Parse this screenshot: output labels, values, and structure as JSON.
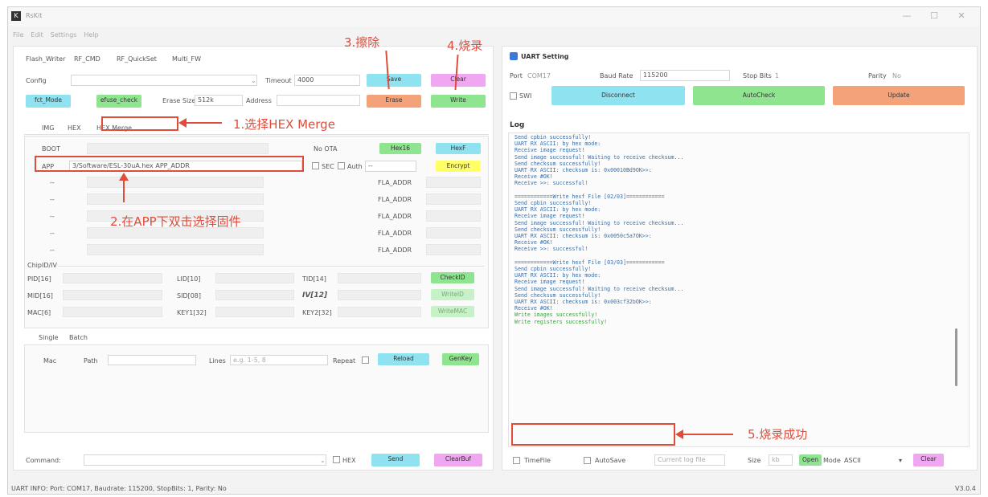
{
  "window": {
    "app_title": "RsKit",
    "logo": "K",
    "minimize": "—",
    "maximize": "☐",
    "close": "✕"
  },
  "menu": [
    "File",
    "Edit",
    "Settings",
    "Help"
  ],
  "tabs_top": [
    "Flash_Writer",
    "RF_CMD",
    "RF_QuickSet",
    "Multi_FW"
  ],
  "flash": {
    "config_label": "Config",
    "timeout_label": "Timeout",
    "timeout_value": "4000",
    "save": "Save",
    "clear": "Clear",
    "fct_mode": "fct_Mode",
    "efuse_check": "efuse_check",
    "erase_size_label": "Erase Size",
    "erase_size": "512k",
    "address_label": "Address",
    "erase": "Erase",
    "write": "Write"
  },
  "sub_tabs": [
    "IMG",
    "HEX",
    "HEX Merge"
  ],
  "hex_merge": {
    "boot": "BOOT",
    "no_ota": "No OTA",
    "hex16": "Hex16",
    "hexf": "HexF",
    "app": "APP",
    "app_path": "3/Software/ESL-30uA.hex",
    "app_addr": "APP_ADDR",
    "sec": "SEC",
    "auth": "Auth",
    "auth_value": "--",
    "encrypt": "Encrypt",
    "rows": [
      {
        "sel": "--",
        "addr": "FLA_ADDR"
      },
      {
        "sel": "--",
        "addr": "FLA_ADDR"
      },
      {
        "sel": "--",
        "addr": "FLA_ADDR"
      },
      {
        "sel": "--",
        "addr": "FLA_ADDR"
      },
      {
        "sel": "--",
        "addr": "FLA_ADDR"
      }
    ]
  },
  "chip": {
    "title": "ChipID/IV",
    "pid": "PID[16]",
    "lid": "LID[10]",
    "tid": "TID[14]",
    "checkid": "CheckID",
    "mid": "MID[16]",
    "sid": "SID[08]",
    "iv": "IV[12]",
    "writeid": "WriteID",
    "mac": "MAC[6]",
    "key1": "KEY1[32]",
    "key2": "KEY2[32]",
    "writemac": "WriteMAC"
  },
  "batch_tabs": [
    "Single",
    "Batch"
  ],
  "batch": {
    "mac": "Mac",
    "path": "Path",
    "lines_label": "Lines",
    "lines_placeholder": "e.g. 1-5, 8",
    "repeat": "Repeat",
    "reload": "Reload",
    "genkey": "GenKey"
  },
  "command": {
    "label": "Command:",
    "hex": "HEX",
    "send": "Send",
    "clearbuf": "ClearBuf"
  },
  "status_bar": {
    "info": "UART INFO: Port: COM17, Baudrate: 115200, StopBits: 1, Parity: No",
    "version": "V3.0.4"
  },
  "uart": {
    "title": "UART Setting",
    "port_label": "Port",
    "port": "COM17",
    "baud_label": "Baud Rate",
    "baud": "115200",
    "stop_label": "Stop Bits",
    "stop": "1",
    "parity_label": "Parity",
    "parity": "No",
    "swi": "SWI",
    "disconnect": "Disconnect",
    "autocheck": "AutoCheck",
    "update": "Update"
  },
  "log": {
    "title": "Log",
    "lines": [
      {
        "text": "Send cpbin successfully!",
        "green": false
      },
      {
        "text": "UART RX ASCII: by hex mode:",
        "green": false
      },
      {
        "text": "Receive image request!",
        "green": false
      },
      {
        "text": "Send image successful! Waiting to receive checksum...",
        "green": false
      },
      {
        "text": "Send checksum successfully!",
        "green": false
      },
      {
        "text": "UART RX ASCII: checksum is: 0x00010Bd9OK>>:",
        "green": false
      },
      {
        "text": "Receive #OK!",
        "green": false
      },
      {
        "text": "Receive >>: successful!",
        "green": false
      },
      {
        "text": "",
        "green": false
      },
      {
        "text": "============Write hexf File [02/03]============",
        "green": false
      },
      {
        "text": "Send cpbin successfully!",
        "green": false
      },
      {
        "text": "UART RX ASCII: by hex mode:",
        "green": false
      },
      {
        "text": "Receive image request!",
        "green": false
      },
      {
        "text": "Send image successful! Waiting to receive checksum...",
        "green": false
      },
      {
        "text": "Send checksum successfully!",
        "green": false
      },
      {
        "text": "UART RX ASCII: checksum is: 0x0050c5a7OK>>:",
        "green": false
      },
      {
        "text": "Receive #OK!",
        "green": false
      },
      {
        "text": "Receive >>: successful!",
        "green": false
      },
      {
        "text": "",
        "green": false
      },
      {
        "text": "============Write hexf File [03/03]============",
        "green": false
      },
      {
        "text": "Send cpbin successfully!",
        "green": false
      },
      {
        "text": "UART RX ASCII: by hex mode:",
        "green": false
      },
      {
        "text": "Receive image request!",
        "green": false
      },
      {
        "text": "Send image successful! Waiting to receive checksum...",
        "green": false
      },
      {
        "text": "Send checksum successfully!",
        "green": false
      },
      {
        "text": "UART RX ASCII: checksum is: 0x003cf32bOK>>:",
        "green": false
      },
      {
        "text": "Receive #OK!",
        "green": false
      },
      {
        "text": "Write images successfully!",
        "green": true
      },
      {
        "text": "Write registers successfully!",
        "green": true
      }
    ],
    "timefile": "TimeFile",
    "autosave": "AutoSave",
    "current_log_file": "Current log file",
    "size_label": "Size",
    "size_unit": "kb",
    "open": "Open",
    "mode_label": "Mode",
    "mode": "ASCII",
    "clear": "Clear"
  },
  "annotations": {
    "a1": "1.选择HEX Merge",
    "a2": "2.在APP下双击选择固件",
    "a3": "3.擦除",
    "a4": "4.烧录",
    "a5": "5.烧录成功"
  }
}
